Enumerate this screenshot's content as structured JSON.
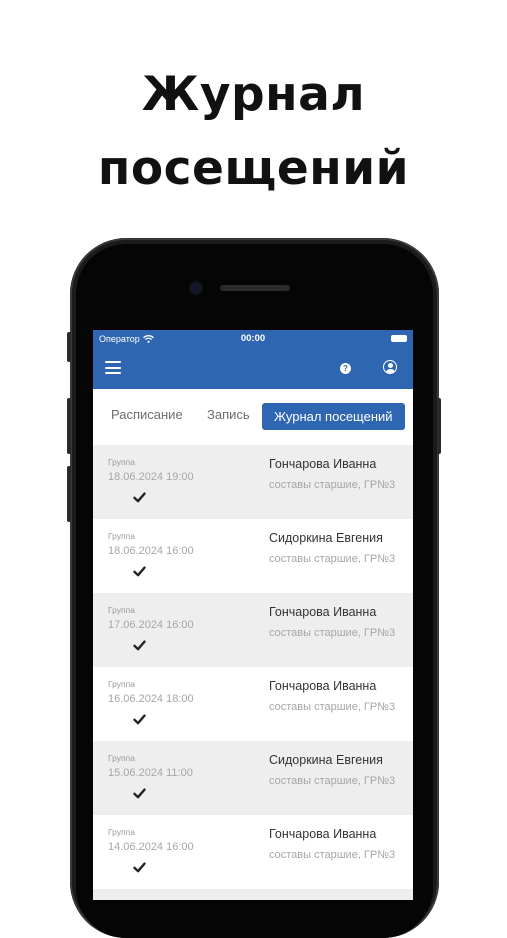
{
  "headline": {
    "line1": "Журнал",
    "line2": "посещений"
  },
  "status_bar": {
    "operator": "Оператор",
    "time": "00:00"
  },
  "tabs": [
    {
      "label": "Расписание",
      "active": false
    },
    {
      "label": "Запись",
      "active": false
    },
    {
      "label": "Журнал посещений",
      "active": true
    }
  ],
  "entries": [
    {
      "group_label": "Группа",
      "datetime": "18.06.2024 19:00",
      "name": "Гончарова Иванна",
      "details": "составы старшие, ГР№3",
      "checked": true
    },
    {
      "group_label": "Группа",
      "datetime": "18.06.2024 16:00",
      "name": "Сидоркина Евгения",
      "details": "составы старшие, ГР№3",
      "checked": true
    },
    {
      "group_label": "Группа",
      "datetime": "17.06.2024 16:00",
      "name": "Гончарова Иванна",
      "details": "составы старшие, ГР№3",
      "checked": true
    },
    {
      "group_label": "Группа",
      "datetime": "16.06.2024 18:00",
      "name": "Гончарова Иванна",
      "details": "составы старшие, ГР№3",
      "checked": true
    },
    {
      "group_label": "Группа",
      "datetime": "15.06.2024 11:00",
      "name": "Сидоркина Евгения",
      "details": "составы старшие, ГР№3",
      "checked": true
    },
    {
      "group_label": "Группа",
      "datetime": "14.06.2024 16:00",
      "name": "Гончарова Иванна",
      "details": "составы старшие, ГР№3",
      "checked": true
    }
  ],
  "icons": {
    "menu": "hamburger-menu-icon",
    "help": "help-icon",
    "profile": "user-profile-icon",
    "check": "checkmark-icon",
    "wifi": "wifi-icon",
    "battery": "battery-icon"
  },
  "colors": {
    "accent": "#2f66b1",
    "row_alt": "#eeeeee"
  }
}
